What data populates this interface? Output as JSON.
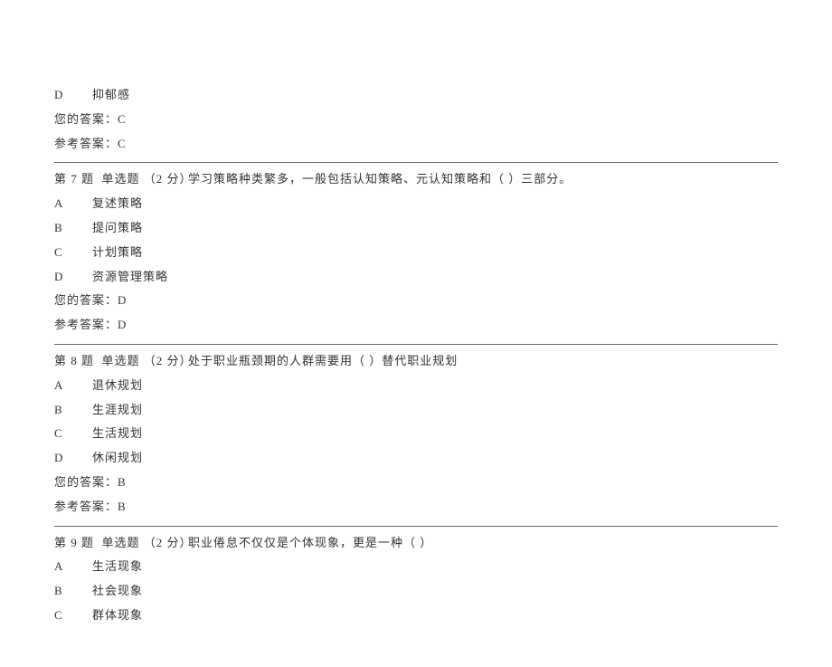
{
  "labels": {
    "your_answer_prefix": "您的答案：",
    "ref_answer_prefix": "参考答案："
  },
  "partial_q6": {
    "trailing_options": [
      {
        "letter": "D",
        "text": "抑郁感"
      }
    ],
    "your_answer": "C",
    "ref_answer": "C"
  },
  "questions": [
    {
      "number": "第 7 题",
      "type": "单选题",
      "points": "（2 分）",
      "stem": "学习策略种类繁多，一般包括认知策略、元认知策略和（  ）三部分。",
      "options": [
        {
          "letter": "A",
          "text": "复述策略"
        },
        {
          "letter": "B",
          "text": "提问策略"
        },
        {
          "letter": "C",
          "text": "计划策略"
        },
        {
          "letter": "D",
          "text": "资源管理策略"
        }
      ],
      "your_answer": "D",
      "ref_answer": "D"
    },
    {
      "number": "第 8 题",
      "type": "单选题",
      "points": "（2 分）",
      "stem": "处于职业瓶颈期的人群需要用（  ）替代职业规划",
      "options": [
        {
          "letter": "A",
          "text": "退休规划"
        },
        {
          "letter": "B",
          "text": "生涯规划"
        },
        {
          "letter": "C",
          "text": "生活规划"
        },
        {
          "letter": "D",
          "text": "休闲规划"
        }
      ],
      "your_answer": "B",
      "ref_answer": "B"
    },
    {
      "number": "第 9 题",
      "type": "单选题",
      "points": "（2 分）",
      "stem": "职业倦怠不仅仅是个体现象，更是一种（  ）",
      "options": [
        {
          "letter": "A",
          "text": "生活现象"
        },
        {
          "letter": "B",
          "text": "社会现象"
        },
        {
          "letter": "C",
          "text": "群体现象"
        }
      ],
      "your_answer": null,
      "ref_answer": null
    }
  ]
}
